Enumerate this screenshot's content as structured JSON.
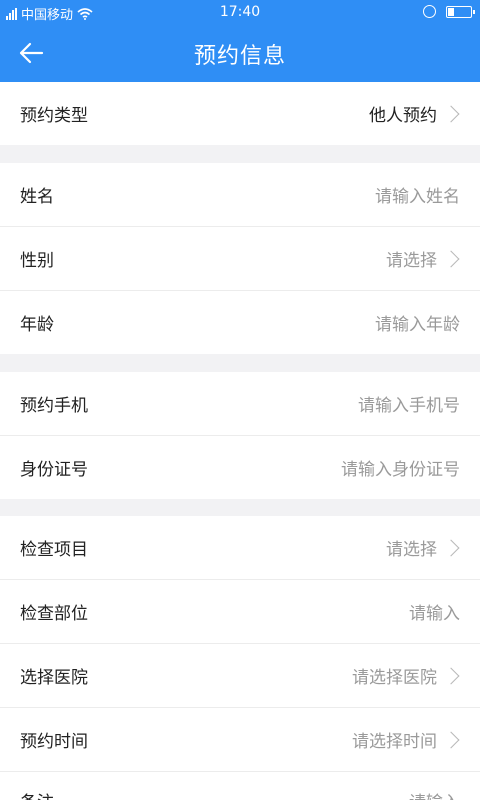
{
  "status_bar": {
    "carrier": "中国移动",
    "time": "17:40",
    "battery_level": 0.25
  },
  "header": {
    "back_icon": "arrow-left-icon",
    "title": "预约信息"
  },
  "form": {
    "appointment_type": {
      "label": "预约类型",
      "value": "他人预约"
    },
    "name": {
      "label": "姓名",
      "placeholder": "请输入姓名"
    },
    "gender": {
      "label": "性别",
      "placeholder": "请选择"
    },
    "age": {
      "label": "年龄",
      "placeholder": "请输入年龄"
    },
    "phone": {
      "label": "预约手机",
      "placeholder": "请输入手机号"
    },
    "id_number": {
      "label": "身份证号",
      "placeholder": "请输入身份证号"
    },
    "exam_item": {
      "label": "检查项目",
      "placeholder": "请选择"
    },
    "exam_part": {
      "label": "检查部位",
      "placeholder": "请输入"
    },
    "hospital": {
      "label": "选择医院",
      "placeholder": "请选择医院"
    },
    "time": {
      "label": "预约时间",
      "placeholder": "请选择时间"
    },
    "remark": {
      "label": "备注",
      "placeholder": "请输入"
    }
  },
  "colors": {
    "primary": "#2f8ef5",
    "background": "#f2f2f4",
    "placeholder": "#9a9a9a"
  }
}
